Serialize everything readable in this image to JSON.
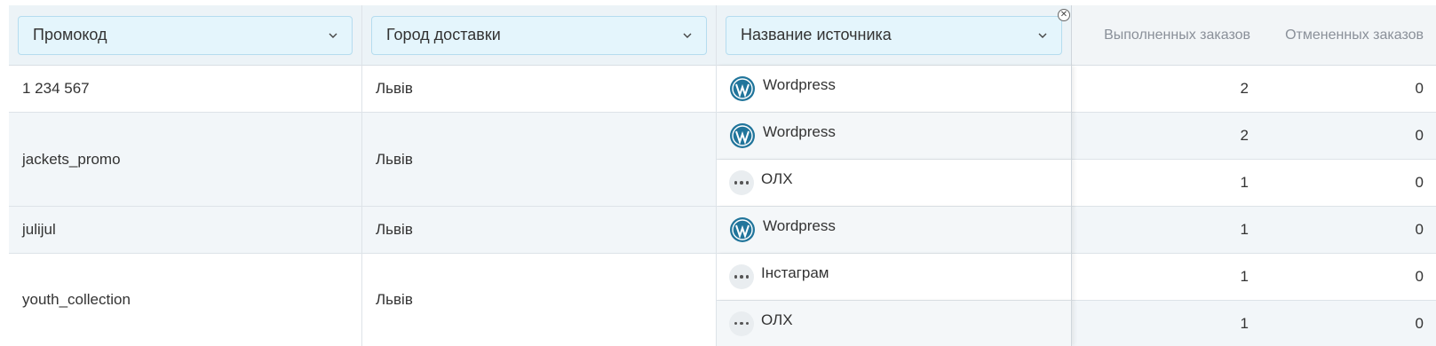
{
  "header": {
    "promo_filter": "Промокод",
    "city_filter": "Город доставки",
    "source_filter": "Название источника",
    "completed_col": "Выполненных заказов",
    "canceled_col": "Отмененных заказов"
  },
  "rows": [
    {
      "promo": "1 234 567",
      "city": "Львів",
      "sources": [
        {
          "name": "Wordpress",
          "icon": "wordpress-icon",
          "completed": "2",
          "canceled": "0"
        }
      ]
    },
    {
      "promo": "jackets_promo",
      "city": "Львів",
      "sources": [
        {
          "name": "Wordpress",
          "icon": "wordpress-icon",
          "completed": "2",
          "canceled": "0"
        },
        {
          "name": "ОЛХ",
          "icon": "more-dots-icon",
          "completed": "1",
          "canceled": "0"
        }
      ]
    },
    {
      "promo": "julijul",
      "city": "Львів",
      "sources": [
        {
          "name": "Wordpress",
          "icon": "wordpress-icon",
          "completed": "1",
          "canceled": "0"
        }
      ]
    },
    {
      "promo": "youth_collection",
      "city": "Львів",
      "sources": [
        {
          "name": "Інстаграм",
          "icon": "more-dots-icon",
          "completed": "1",
          "canceled": "0"
        },
        {
          "name": "ОЛХ",
          "icon": "more-dots-icon",
          "completed": "1",
          "canceled": "0"
        }
      ]
    }
  ],
  "colors": {
    "header_bg": "#ecf3f7",
    "filter_bg": "#e4f5fc",
    "filter_border": "#b5dcef",
    "wordpress_blue": "#21759b"
  }
}
